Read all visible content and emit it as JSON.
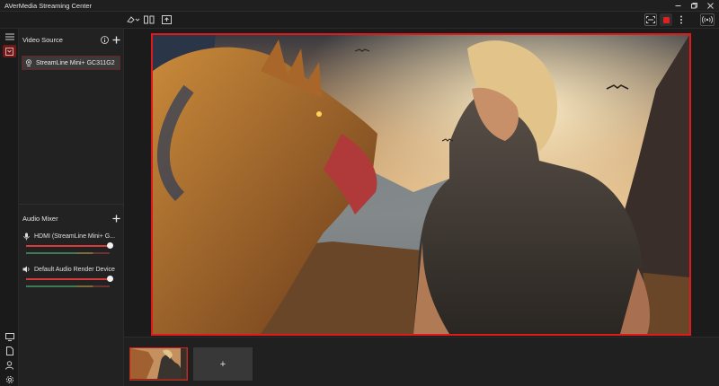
{
  "window": {
    "title": "AVerMedia Streaming Center",
    "controls": [
      "minimize",
      "restore",
      "close"
    ]
  },
  "toolbar": {
    "left_tools": [
      "eraser-dropdown-icon",
      "layout-split-icon",
      "screen-share-icon"
    ],
    "right_tools": [
      "fit-screen-icon",
      "record-stop-icon",
      "more-vertical-icon",
      "broadcast-icon"
    ],
    "record_color": "#e02020"
  },
  "rail": {
    "top_items": [
      "menu-icon",
      "video-source-icon"
    ],
    "bottom_items": [
      "monitor-icon",
      "document-icon",
      "user-icon",
      "settings-icon"
    ]
  },
  "video_source": {
    "title": "Video Source",
    "items": [
      {
        "label": "StreamLine Mini+ GC311G2",
        "icon": "webcam-icon",
        "selected": true
      }
    ]
  },
  "audio_mixer": {
    "title": "Audio Mixer",
    "channels": [
      {
        "label": "HDMI (StreamLine Mini+ G...",
        "icon": "microphone-icon",
        "volume": 1.0
      },
      {
        "label": "Default Audio Render Device",
        "icon": "speaker-icon",
        "volume": 1.0
      }
    ]
  },
  "scenes": {
    "add_label": "+"
  },
  "colors": {
    "accent_red": "#e01a1a",
    "background": "#1b1b1b",
    "panel": "#222222"
  }
}
